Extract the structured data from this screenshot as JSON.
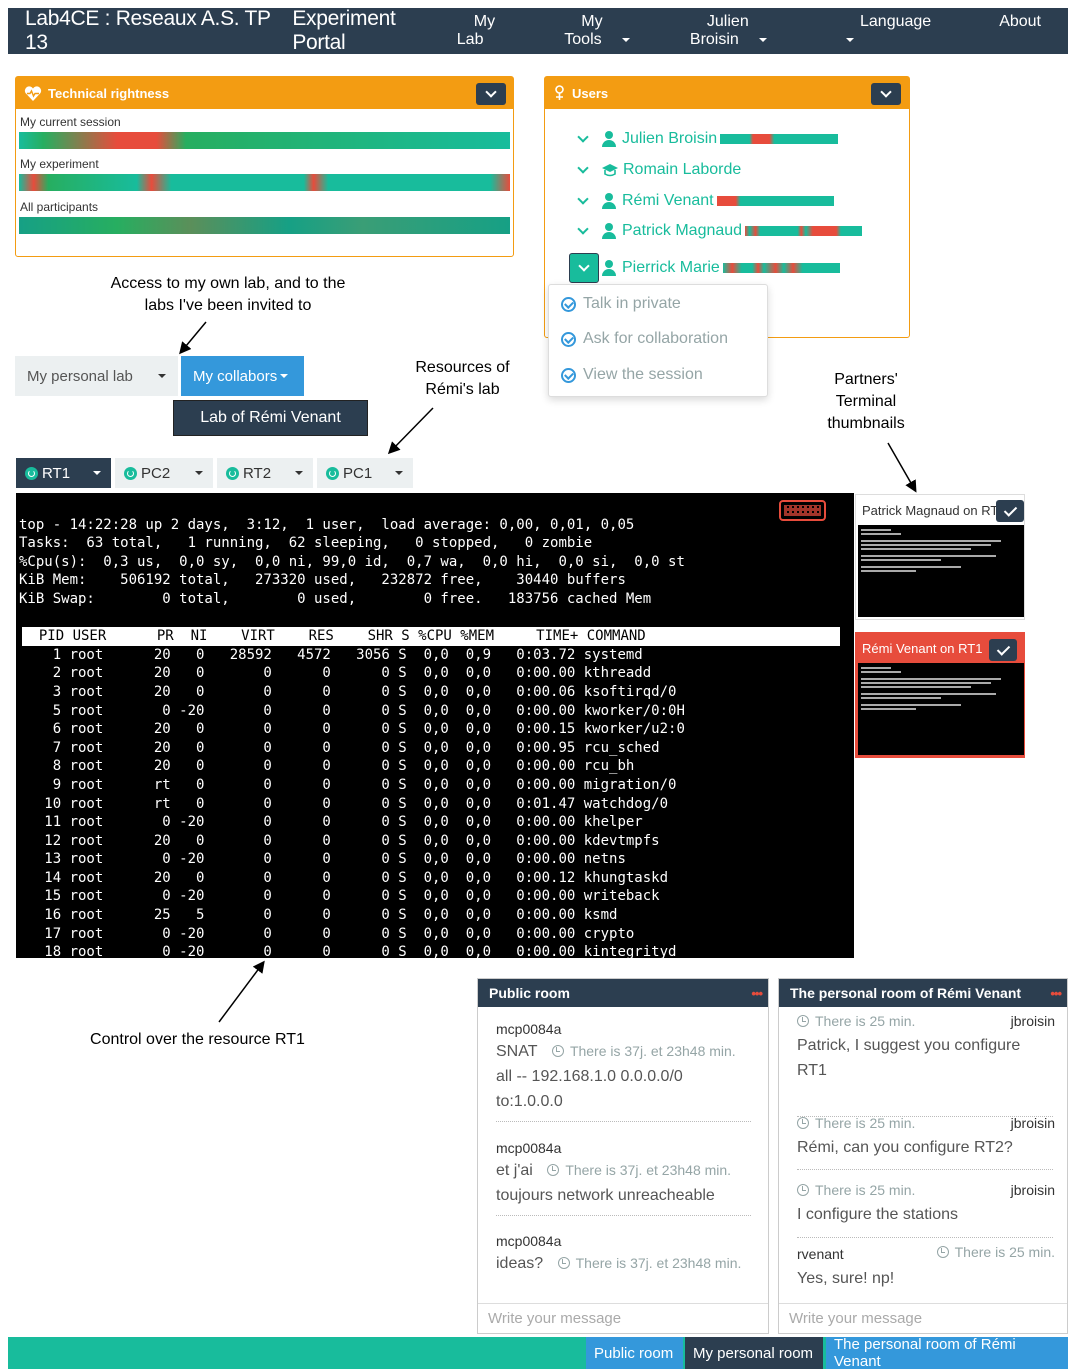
{
  "navbar": {
    "brand": "Lab4CE : Reseaux A.S. TP 13",
    "portal": "Experiment Portal",
    "items": [
      "My Lab",
      "My Tools",
      "Julien Broisin",
      "Language",
      "About"
    ]
  },
  "tech_panel": {
    "title": "Technical rightness",
    "labels": [
      "My current session",
      "My experiment",
      "All participants"
    ]
  },
  "users_panel": {
    "title": "Users",
    "users": [
      "Julien Broisin",
      "Romain Laborde",
      "Rémi Venant",
      "Patrick Magnaud",
      "Pierrick Marie"
    ]
  },
  "user_menu": {
    "items": [
      "Talk in private",
      "Ask for collaboration",
      "View the session"
    ]
  },
  "annotations": {
    "own_lab": "Access to my own lab, and to the labs I've been invited to",
    "resources": "Resources of Rémi's lab",
    "partners": "Partners' Terminal thumbnails",
    "control": "Control over the resource RT1"
  },
  "lab_buttons": {
    "personal": "My personal lab",
    "collabors": "My collabors",
    "collab_item": "Lab of Rémi Venant"
  },
  "resource_tabs": [
    "RT1",
    "PC2",
    "RT2",
    "PC1"
  ],
  "terminal": {
    "lines": [
      "top - 14:22:28 up 2 days,  3:12,  1 user,  load average: 0,00, 0,01, 0,05",
      "Tasks:  63 total,   1 running,  62 sleeping,   0 stopped,   0 zombie",
      "%Cpu(s):  0,3 us,  0,0 sy,  0,0 ni, 99,0 id,  0,7 wa,  0,0 hi,  0,0 si,  0,0 st",
      "KiB Mem:    506192 total,   273320 used,   232872 free,    30440 buffers",
      "KiB Swap:        0 total,        0 used,        0 free.   183756 cached Mem",
      ""
    ],
    "header": "  PID USER      PR  NI    VIRT    RES    SHR S %CPU %MEM     TIME+ COMMAND",
    "rows": [
      "    1 root      20   0   28592   4572   3056 S  0,0  0,9   0:03.72 systemd",
      "    2 root      20   0       0      0      0 S  0,0  0,0   0:00.00 kthreadd",
      "    3 root      20   0       0      0      0 S  0,0  0,0   0:00.06 ksoftirqd/0",
      "    5 root       0 -20       0      0      0 S  0,0  0,0   0:00.00 kworker/0:0H",
      "    6 root      20   0       0      0      0 S  0,0  0,0   0:00.15 kworker/u2:0",
      "    7 root      20   0       0      0      0 S  0,0  0,0   0:00.95 rcu_sched",
      "    8 root      20   0       0      0      0 S  0,0  0,0   0:00.00 rcu_bh",
      "    9 root      rt   0       0      0      0 S  0,0  0,0   0:00.00 migration/0",
      "   10 root      rt   0       0      0      0 S  0,0  0,0   0:01.47 watchdog/0",
      "   11 root       0 -20       0      0      0 S  0,0  0,0   0:00.00 khelper",
      "   12 root      20   0       0      0      0 S  0,0  0,0   0:00.00 kdevtmpfs",
      "   13 root       0 -20       0      0      0 S  0,0  0,0   0:00.00 netns",
      "   14 root      20   0       0      0      0 S  0,0  0,0   0:00.12 khungtaskd",
      "   15 root       0 -20       0      0      0 S  0,0  0,0   0:00.00 writeback",
      "   16 root      25   5       0      0      0 S  0,0  0,0   0:00.00 ksmd",
      "   17 root       0 -20       0      0      0 S  0,0  0,0   0:00.00 crypto",
      "   18 root       0 -20       0      0      0 S  0,0  0,0   0:00.00 kintegrityd"
    ]
  },
  "thumbnails": [
    {
      "title": "Patrick Magnaud on RT1",
      "color": "#ffffff"
    },
    {
      "title": "Rémi Venant on RT1",
      "color": "#e74c3c"
    }
  ],
  "public_room": {
    "title": "Public room",
    "messages": [
      {
        "user": "mcp0084a",
        "time": "There is 37j. et 23h48 min.",
        "text_a": "SNAT",
        "text_b": "all -- 192.168.1.0 0.0.0.0/0 to:1.0.0.0"
      },
      {
        "user": "mcp0084a",
        "time": "There is 37j. et 23h48 min.",
        "text_a": "et j'ai",
        "text_b": "toujours network unreacheable"
      },
      {
        "user": "mcp0084a",
        "time": "There is 37j. et 23h48 min.",
        "text_a": "ideas?",
        "text_b": ""
      }
    ],
    "placeholder": "Write your message"
  },
  "personal_room": {
    "title": "The personal room of Rémi Venant",
    "messages": [
      {
        "user": "jbroisin",
        "time": "There is 25 min.",
        "text": "Patrick, I suggest you configure RT1"
      },
      {
        "user": "jbroisin",
        "time": "There is 25 min.",
        "text": "Rémi, can you configure RT2?"
      },
      {
        "user": "jbroisin",
        "time": "There is 25 min.",
        "text": "I configure the stations"
      },
      {
        "user": "rvenant",
        "time": "There is 25 min.",
        "text": "Yes, sure! np!"
      }
    ],
    "placeholder": "Write your message"
  },
  "footer_tabs": [
    "Public room",
    "My personal room",
    "The personal room of Rémi Venant"
  ],
  "colors": {
    "navbar": "#2c3e50",
    "accent": "#18bc9c",
    "warning": "#f39c12",
    "danger": "#e74c3c",
    "primary": "#3498db"
  }
}
